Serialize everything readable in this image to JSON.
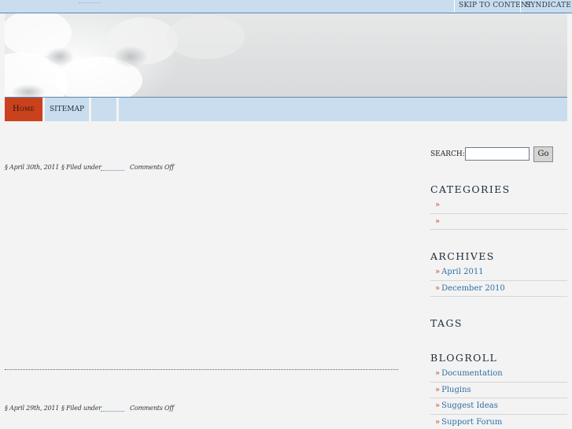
{
  "topbar": {
    "skip_label": "Skip to Content",
    "syndicate_label": "Syndicate"
  },
  "nav": {
    "home_label": "Home",
    "sitemap_label": "Sitemap"
  },
  "posts": [
    {
      "date": "April 30th, 2011",
      "filed_under": "Filed under",
      "comments": "Comments Off"
    },
    {
      "date": "April 29th, 2011",
      "filed_under": "Filed under",
      "comments": "Comments Off"
    }
  ],
  "sidebar": {
    "search_label": "Search:",
    "search_value": "",
    "go_label": "Go",
    "categories_title": "Categories",
    "categories": [
      {
        "arrow": "»",
        "label": ""
      },
      {
        "arrow": "»",
        "label": ""
      }
    ],
    "archives_title": "Archives",
    "archives": [
      {
        "arrow": "»",
        "label": "April 2011"
      },
      {
        "arrow": "»",
        "label": "December 2010"
      }
    ],
    "tags_title": "Tags",
    "blogroll_title": "Blogroll",
    "blogroll": [
      {
        "arrow": "»",
        "label": "Documentation"
      },
      {
        "arrow": "»",
        "label": "Plugins"
      },
      {
        "arrow": "»",
        "label": "Suggest Ideas"
      },
      {
        "arrow": "»",
        "label": "Support Forum"
      }
    ]
  },
  "colors": {
    "accent": "#c9421d",
    "nav_bg": "#c9ddee",
    "link": "#2e6fa3",
    "page_bg": "#f3f3f3"
  }
}
